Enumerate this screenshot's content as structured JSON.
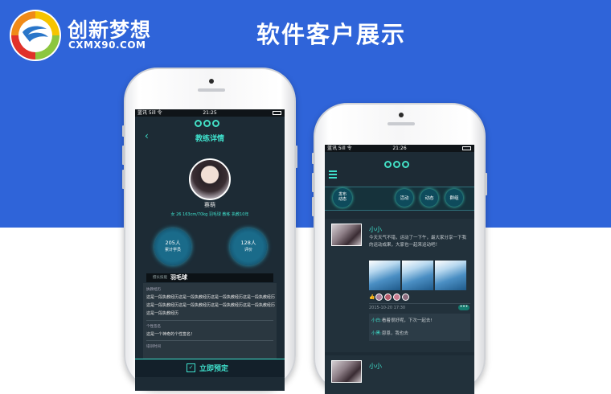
{
  "brand": {
    "name": "创新梦想",
    "url": "CXMX90.COM"
  },
  "page_title": "软件客户展示",
  "phone1": {
    "status": {
      "left": "蓝讯 5ill 令",
      "time": "21:25"
    },
    "header_title": "教练详情",
    "back": "‹",
    "coach_name": "蔡萌",
    "coach_info": "女 26 163cm/70kg 羽毛球 教练 执教10年",
    "stats": [
      {
        "value": "205人",
        "label": "累计学员"
      },
      {
        "value": "128人",
        "label": "评价"
      }
    ],
    "tab_label": "擅长技能",
    "tab_value": "羽毛球",
    "section1_title": "执教经历",
    "section1_text": "这是一段执教经历这是一段执教经历这是一段执教经历这是一段执教经历这是一段执教经历这是一段执教经历这是一段执教经历这是一段执教经历这是一段执教经历",
    "section2_title": "个性签名",
    "section2_text": "这是一个神奇的个性签名！",
    "section3_title": "培训时间",
    "cta": "立即预定"
  },
  "phone2": {
    "status": {
      "left": "蓝讯 5ill 令",
      "time": "21:26"
    },
    "publish": "发布\n动态",
    "tabs": [
      "活动",
      "动态",
      "群组"
    ],
    "posts": [
      {
        "user": "小小",
        "text": "今天天气不错，运动了一下午，最大家分享一下我的运动成果，大家也一起来运动吧！",
        "time": "2015-10-20 17:30",
        "comments": [
          {
            "user": "小白:",
            "text": "看着很好呢，下次一起去!"
          },
          {
            "user": "小黑:",
            "text": "恩恩，我也去"
          }
        ]
      },
      {
        "user": "小小"
      }
    ]
  },
  "colors": {
    "blue": "#2f64d9",
    "teal": "#3fe0cc",
    "screen": "#1d2b35"
  }
}
